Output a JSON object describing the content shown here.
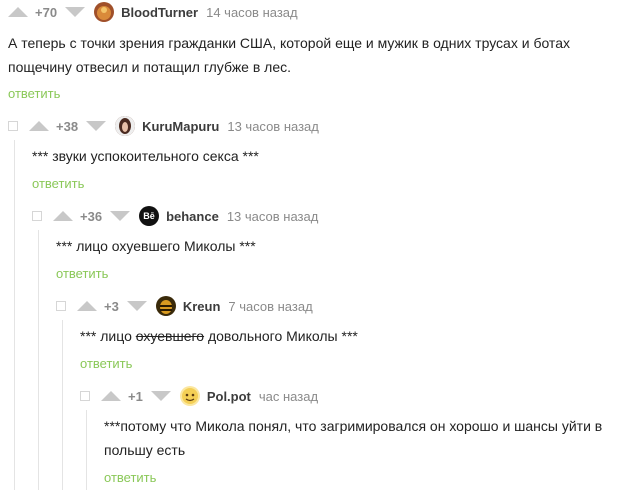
{
  "comments": [
    {
      "rating": "+70",
      "nick": "BloodTurner",
      "time": "14 часов назад",
      "text": "А теперь с точки зрения гражданки США, которой еще и мужик в одних трусах и ботах пощечину отвесил и потащил глубже в лес.",
      "reply": "ответить",
      "avatar_color": "#a0502a"
    },
    {
      "rating": "+38",
      "nick": "KuruMapuru",
      "time": "13 часов назад",
      "text": "*** звуки успокоительного секса ***",
      "reply": "ответить",
      "avatar_color": "#6b3a2a"
    },
    {
      "rating": "+36",
      "nick": "behance",
      "time": "13 часов назад",
      "text": "*** лицо охуевшего Миколы ***",
      "reply": "ответить",
      "avatar_color": "#111111",
      "avatar_glyph": "Bē"
    },
    {
      "rating": "+3",
      "nick": "Kreun",
      "time": "7 часов назад",
      "text_before": "*** лицо ",
      "text_strike": "охуевшего",
      "text_after": " довольного Миколы ***",
      "reply": "ответить",
      "avatar_color": "#3a2a0a"
    },
    {
      "rating": "+1",
      "nick": "Pol.pot",
      "time": "час назад",
      "text": "***потому что Микола понял, что загримировался он хорошо и шансы уйти в польшу есть",
      "reply": "ответить",
      "avatar_color": "#f2d36b"
    }
  ]
}
